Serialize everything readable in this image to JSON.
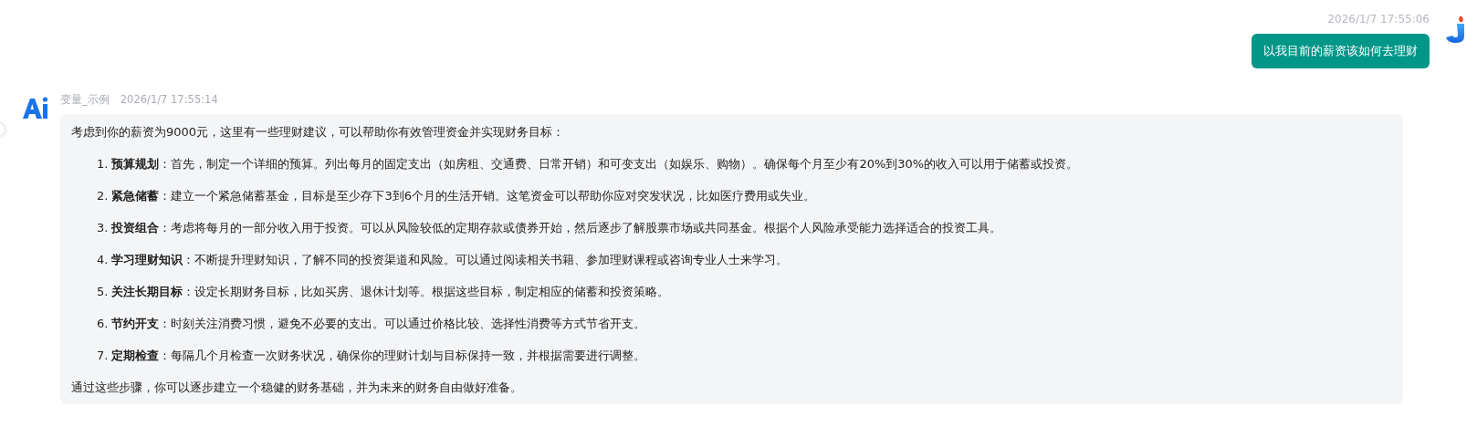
{
  "user_message": {
    "time": "2026/1/7 17:55:06",
    "text": "以我目前的薪资该如何去理财"
  },
  "ai_message": {
    "sender": "变量_示例",
    "time": "2026/1/7 17:55:14",
    "intro": "考虑到你的薪资为9000元，这里有一些理财建议，可以帮助你有效管理资金并实现财务目标：",
    "items": [
      {
        "number": "1.",
        "text": "**预算规划**：首先，制定一个详细的预算。列出每月的固定支出（如房租、交通费、日常开销）和可变支出（如娱乐、购物）。确保每个月至少有20%到30%的收入可以用于储蓄或投资。"
      },
      {
        "number": "2.",
        "text": "**紧急储蓄**：建立一个紧急储蓄基金，目标是至少存下3到6个月的生活开销。这笔资金可以帮助你应对突发状况，比如医疗费用或失业。"
      },
      {
        "number": "3.",
        "text": "**投资组合**：考虑将每月的一部分收入用于投资。可以从风险较低的定期存款或债券开始，然后逐步了解股票市场或共同基金。根据个人风险承受能力选择适合的投资工具。"
      },
      {
        "number": "4.",
        "text": "**学习理财知识**：不断提升理财知识，了解不同的投资渠道和风险。可以通过阅读相关书籍、参加理财课程或咨询专业人士来学习。"
      },
      {
        "number": "5.",
        "text": "**关注长期目标**：设定长期财务目标，比如买房、退休计划等。根据这些目标，制定相应的储蓄和投资策略。"
      },
      {
        "number": "6.",
        "text": "**节约开支**：时刻关注消费习惯，避免不必要的支出。可以通过价格比较、选择性消费等方式节省开支。"
      },
      {
        "number": "7.",
        "text": "**定期检查**：每隔几个月检查一次财务状况，确保你的理财计划与目标保持一致，并根据需要进行调整。"
      }
    ],
    "outro": "通过这些步骤，你可以逐步建立一个稳健的财务基础，并为未来的财务自由做好准备。"
  }
}
